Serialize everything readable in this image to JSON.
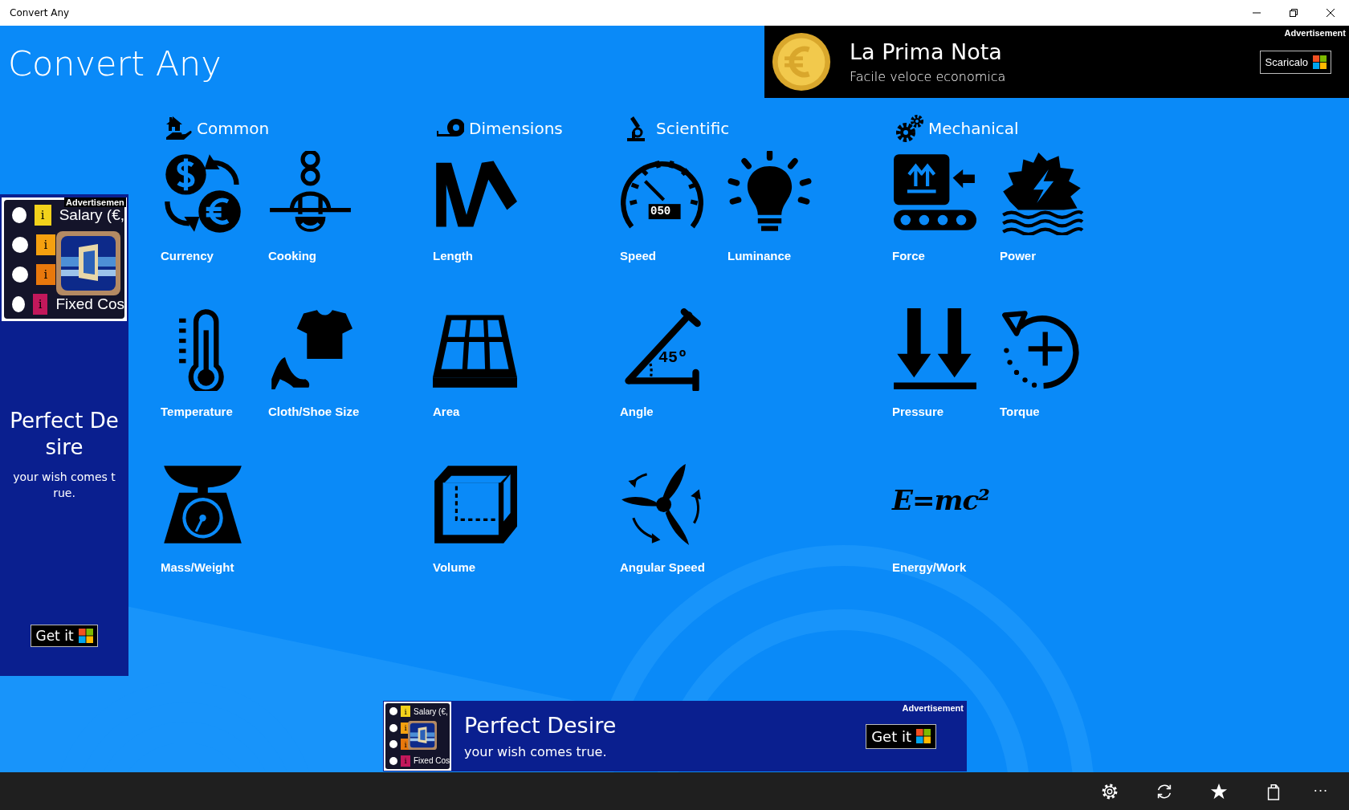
{
  "window": {
    "title": "Convert Any"
  },
  "app_title": "Convert Any",
  "top_ad": {
    "label": "Advertisement",
    "title": "La Prima Nota",
    "subtitle": "Facile veloce economica",
    "button": "Scaricalo"
  },
  "side_ad": {
    "label": "Advertisemen",
    "thumbnail": {
      "top_text": "Salary (€,",
      "bottom_text": "Fixed Cos",
      "markers": [
        {
          "text": "i",
          "color": "#f2d21b"
        },
        {
          "text": "i",
          "color": "#f5a00f"
        },
        {
          "text": "i",
          "color": "#e8780c"
        },
        {
          "text": "i",
          "color": "#c2185b"
        }
      ]
    },
    "title": "Perfect Desire",
    "subtitle": "your wish comes true.",
    "button": "Get it"
  },
  "categories": [
    {
      "title": "Common",
      "rows": [
        [
          {
            "label": "Currency"
          },
          {
            "label": "Cooking"
          }
        ],
        [
          {
            "label": "Temperature"
          },
          {
            "label": "Cloth/Shoe Size"
          }
        ],
        [
          {
            "label": "Mass/Weight"
          }
        ]
      ]
    },
    {
      "title": "Dimensions",
      "rows": [
        [
          {
            "label": "Length"
          }
        ],
        [
          {
            "label": "Area"
          }
        ],
        [
          {
            "label": "Volume"
          }
        ]
      ]
    },
    {
      "title": "Scientific",
      "rows": [
        [
          {
            "label": "Speed",
            "icon_text": "050"
          },
          {
            "label": "Luminance"
          }
        ],
        [
          {
            "label": "Angle",
            "icon_text": "45º"
          }
        ],
        [
          {
            "label": "Angular Speed"
          }
        ]
      ]
    },
    {
      "title": "Mechanical",
      "rows": [
        [
          {
            "label": "Force"
          },
          {
            "label": "Power"
          }
        ],
        [
          {
            "label": "Pressure"
          },
          {
            "label": "Torque"
          }
        ],
        [
          {
            "label": "Energy/Work",
            "icon_text": "E=mc²"
          }
        ]
      ]
    }
  ],
  "bottom_ad": {
    "label": "Advertisement",
    "thumbnail": {
      "top_text": "Salary (€,",
      "bottom_text": "Fixed Cos",
      "markers": [
        {
          "text": "i",
          "color": "#f2d21b"
        },
        {
          "text": "i",
          "color": "#f5a00f"
        },
        {
          "text": "i",
          "color": "#e8780c"
        },
        {
          "text": "i",
          "color": "#c2185b"
        }
      ]
    },
    "title": "Perfect Desire",
    "subtitle": "your wish comes true.",
    "button": "Get it"
  },
  "app_bar": {
    "more": "···"
  }
}
